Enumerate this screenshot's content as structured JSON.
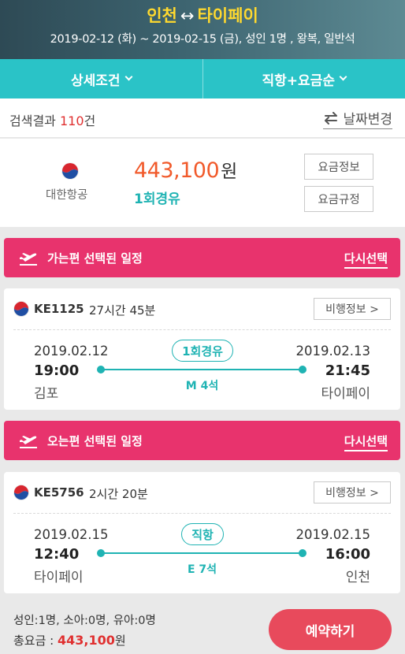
{
  "header": {
    "origin": "인천",
    "arrow": "↔",
    "destination": "타이페이",
    "subtitle": "2019-02-12 (화) ~ 2019-02-15 (금), 성인 1명 , 왕복, 일반석"
  },
  "filters": {
    "detail_label": "상세조건",
    "sort_label": "직항+요금순"
  },
  "results": {
    "prefix": "검색결과 ",
    "count": "110",
    "suffix": "건",
    "date_change_label": "날짜변경"
  },
  "fare": {
    "airline_name": "대한항공",
    "price": "443,100",
    "currency": "원",
    "stops": "1회경유",
    "fare_info_label": "요금정보",
    "fare_rule_label": "요금규정"
  },
  "outbound": {
    "banner_title": "가는편 선택된 일정",
    "reselect_label": "다시선택",
    "flight_no": "KE1125",
    "duration": "27시간 45분",
    "info_label": "비행정보 >",
    "dep_date": "2019.02.12",
    "dep_time": "19:00",
    "dep_city": "김포",
    "arr_date": "2019.02.13",
    "arr_time": "21:45",
    "arr_city": "타이페이",
    "stop_label": "1회경유",
    "seat_class": "M 4석"
  },
  "inbound": {
    "banner_title": "오는편 선택된 일정",
    "reselect_label": "다시선택",
    "flight_no": "KE5756",
    "duration": "2시간 20분",
    "info_label": "비행정보 >",
    "dep_date": "2019.02.15",
    "dep_time": "12:40",
    "dep_city": "타이페이",
    "arr_date": "2019.02.15",
    "arr_time": "16:00",
    "arr_city": "인천",
    "stop_label": "직항",
    "seat_class": "E 7석"
  },
  "footer": {
    "passengers": "성인:1명, 소아:0명, 유아:0명",
    "total_label": "총요금 : ",
    "total_amount": "443,100",
    "total_currency": "원",
    "book_label": "예약하기"
  },
  "colors": {
    "accent_teal": "#2ac3c7",
    "price_orange": "#f15a2b",
    "banner_pink": "#e8336d",
    "book_red": "#e84a5c",
    "title_yellow": "#ffd92e"
  },
  "icons": [
    "korean-air-logo-icon",
    "swap-arrows-icon",
    "chevron-down-icon",
    "plane-takeoff-icon"
  ]
}
